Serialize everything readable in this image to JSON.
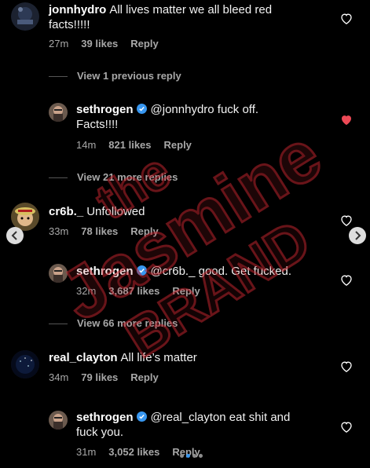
{
  "colors": {
    "background": "#000000",
    "liked_heart": "#ed4956",
    "verified": "#3897f0",
    "watermark": "#c0262f"
  },
  "watermark": {
    "line1": "the",
    "line2": "Jasmine",
    "line3": "BRAND"
  },
  "comments": [
    {
      "user": "jonnhydro",
      "text": "All lives matter we all bleed red facts!!!!!",
      "line_a": "All lives matter we all bleed red",
      "line_b": "facts!!!!!",
      "time": "27m",
      "likes": "39 likes",
      "reply": "Reply",
      "liked": false,
      "avatar_icon": "avatar-image"
    },
    {
      "view_previous": "View 1 previous reply"
    },
    {
      "user": "sethrogen",
      "verified": true,
      "line_a": "@jonnhydro fuck off.",
      "line_b": "Facts!!!!",
      "time": "14m",
      "likes": "821 likes",
      "reply": "Reply",
      "liked": true,
      "view_more": "View 21 more replies"
    },
    {
      "user": "cr6b._",
      "text": "Unfollowed",
      "time": "33m",
      "likes": "78 likes",
      "reply": "Reply",
      "liked": false
    },
    {
      "user": "sethrogen",
      "verified": true,
      "text": "@cr6b._ good. Get fucked.",
      "time": "32m",
      "likes": "3,687 likes",
      "reply": "Reply",
      "liked": false,
      "view_more": "View 66 more replies"
    },
    {
      "user": "real_clayton",
      "text": "All life’s matter",
      "time": "34m",
      "likes": "79 likes",
      "reply": "Reply",
      "liked": false
    },
    {
      "user": "sethrogen",
      "verified": true,
      "line_a": "@real_clayton eat shit and",
      "line_b": "fuck you.",
      "time": "31m",
      "likes": "3,052 likes",
      "reply": "Reply",
      "liked": false
    }
  ],
  "carousel": {
    "prev_icon": "chevron-left-icon",
    "next_icon": "chevron-right-icon",
    "dots": 4,
    "active_dot": 2
  }
}
